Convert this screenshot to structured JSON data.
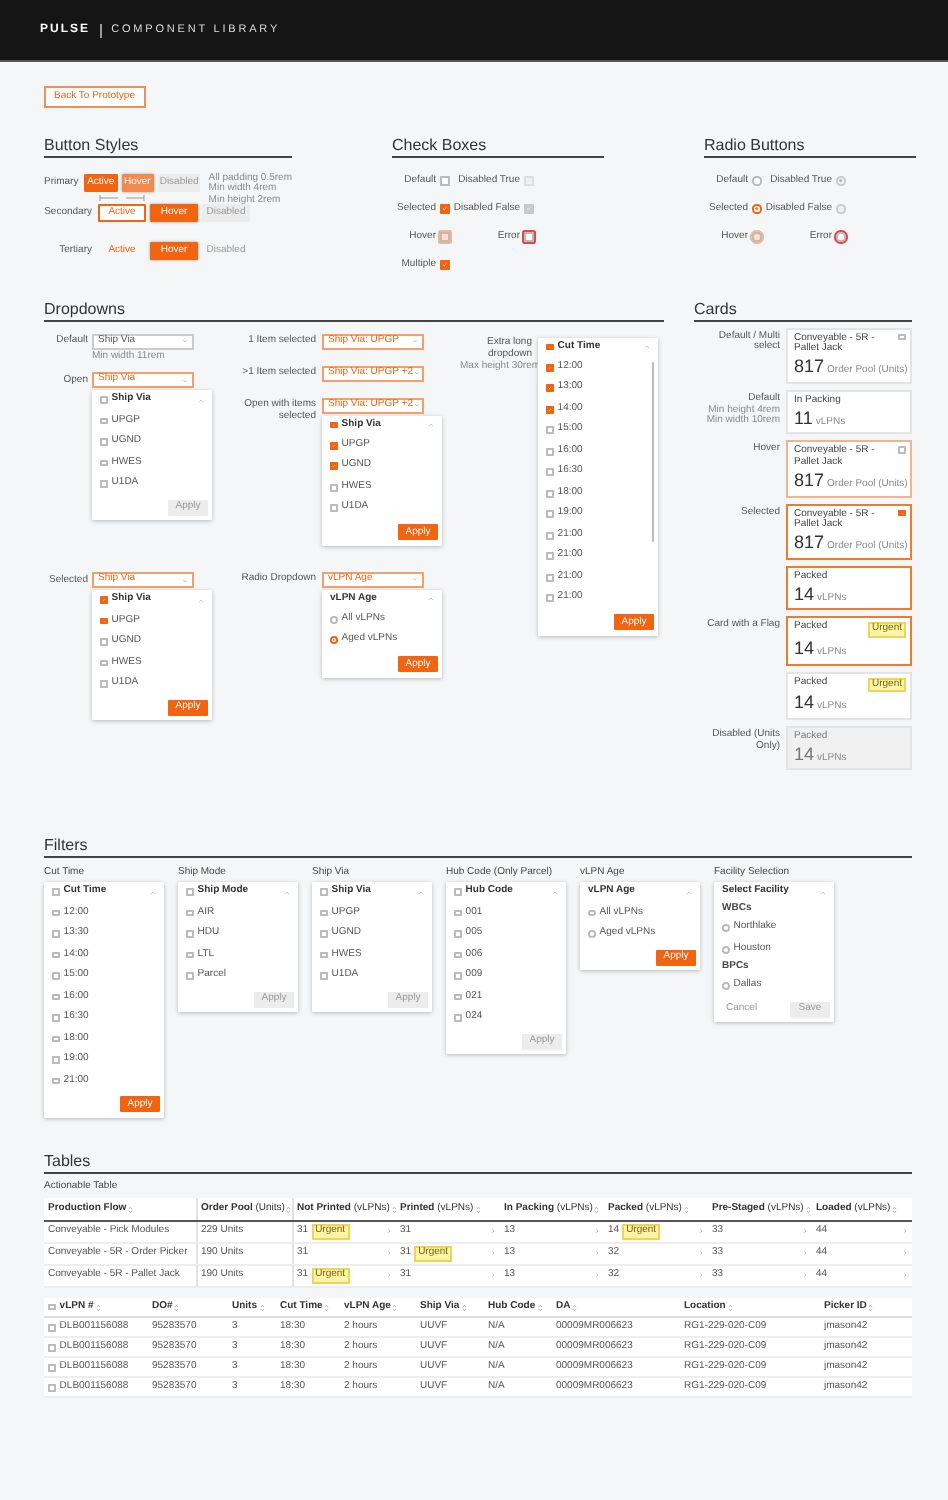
{
  "header": {
    "logo": "PULSE",
    "title": "COMPONENT LIBRARY"
  },
  "back_button": "Back To Prototype",
  "button_styles": {
    "title": "Button Styles",
    "rows": [
      {
        "label": "Primary",
        "kind": "primary",
        "buttons": [
          {
            "text": "Active",
            "hover": false,
            "disabled": false
          },
          {
            "text": "Hover",
            "hover": true,
            "disabled": false
          },
          {
            "text": "Disabled",
            "hover": false,
            "disabled": true
          }
        ]
      },
      {
        "label": "Secondary",
        "kind": "secondary",
        "buttons": [
          {
            "text": "Active",
            "hover": false,
            "disabled": false
          },
          {
            "text": "Hover",
            "hover": true,
            "disabled": false
          },
          {
            "text": "Disabled",
            "hover": false,
            "disabled": true
          }
        ]
      },
      {
        "label": "Tertiary",
        "kind": "tertiary",
        "buttons": [
          {
            "text": "Active",
            "hover": false,
            "disabled": false
          },
          {
            "text": "Hover",
            "hover": true,
            "disabled": false
          },
          {
            "text": "Disabled",
            "hover": false,
            "disabled": true
          }
        ]
      }
    ],
    "notes": [
      "All padding 0.5rem",
      "Min width 4rem",
      "Min height 2rem"
    ]
  },
  "check_boxes": {
    "title": "Check Boxes",
    "columns": [
      [
        {
          "label": "Default",
          "checked": false,
          "disabled": false,
          "hover": false,
          "error": false
        },
        {
          "label": "Selected",
          "checked": true,
          "disabled": false,
          "hover": false,
          "error": false
        },
        {
          "label": "Hover",
          "checked": false,
          "disabled": false,
          "hover": true,
          "error": false
        },
        {
          "label": "Multiple",
          "checked": true,
          "disabled": false,
          "hover": false,
          "error": false
        }
      ],
      [
        {
          "label": "Disabled True",
          "checked": false,
          "disabled": true,
          "hover": false,
          "error": false
        },
        {
          "label": "Disabled False",
          "checked": true,
          "disabled": true,
          "hover": false,
          "error": false
        },
        {
          "label": "Error",
          "checked": false,
          "disabled": false,
          "hover": false,
          "error": true
        }
      ]
    ]
  },
  "radio_buttons": {
    "title": "Radio Buttons",
    "columns": [
      [
        {
          "label": "Default",
          "selected": false,
          "disabled": false,
          "hover": false,
          "error": false
        },
        {
          "label": "Selected",
          "selected": true,
          "disabled": false,
          "hover": false,
          "error": false
        },
        {
          "label": "Hover",
          "selected": false,
          "disabled": false,
          "hover": true,
          "error": false
        }
      ],
      [
        {
          "label": "Disabled True",
          "selected": true,
          "disabled": true,
          "hover": false,
          "error": false
        },
        {
          "label": "Disabled False",
          "selected": false,
          "disabled": true,
          "hover": false,
          "error": false
        },
        {
          "label": "Error",
          "selected": false,
          "disabled": false,
          "hover": false,
          "error": true
        }
      ]
    ]
  },
  "dropdowns": {
    "title": "Dropdowns",
    "columns": [
      [
        {
          "label": "Default",
          "note": "Min width 11rem",
          "field": {
            "text": "Ship Via",
            "active": false
          }
        },
        {
          "label": "Open",
          "field": {
            "text": "Ship Via",
            "active": true
          },
          "menu": {
            "kind": "checkbox",
            "header": {
              "text": "Ship Via",
              "checked": false,
              "partial": false
            },
            "options": [
              {
                "text": "UPGP",
                "checked": false
              },
              {
                "text": "UGND",
                "checked": false
              },
              {
                "text": "HWES",
                "checked": false
              },
              {
                "text": "U1DA",
                "checked": false
              }
            ],
            "apply": {
              "text": "Apply",
              "disabled": true
            }
          }
        },
        {
          "label": "Selected",
          "field": {
            "text": "Ship Via",
            "active": true
          },
          "menu": {
            "kind": "checkbox",
            "header": {
              "text": "Ship Via",
              "checked": true,
              "partial": false
            },
            "options": [
              {
                "text": "UPGP",
                "checked": true
              },
              {
                "text": "UGND",
                "checked": false
              },
              {
                "text": "HWES",
                "checked": false
              },
              {
                "text": "U1DA",
                "checked": false
              }
            ],
            "apply": {
              "text": "Apply",
              "disabled": false
            }
          }
        }
      ],
      [
        {
          "label": "1 Item selected",
          "field": {
            "text": "Ship Via: UPGP",
            "active": true
          }
        },
        {
          "label": ">1 Item selected",
          "field": {
            "text": "Ship Via: UPGP +2",
            "active": true
          }
        },
        {
          "label": "Open with items selected",
          "field": {
            "text": "Ship Via: UPGP +2",
            "active": true
          },
          "menu": {
            "kind": "checkbox",
            "header": {
              "text": "Ship Via",
              "checked": true,
              "partial": true
            },
            "options": [
              {
                "text": "UPGP",
                "checked": true
              },
              {
                "text": "UGND",
                "checked": true
              },
              {
                "text": "HWES",
                "checked": false
              },
              {
                "text": "U1DA",
                "checked": false
              }
            ],
            "apply": {
              "text": "Apply",
              "disabled": false
            }
          }
        },
        {
          "label": "Radio Dropdown",
          "field": {
            "text": "vLPN Age",
            "active": true
          },
          "menu": {
            "kind": "radio",
            "header": {
              "text": "vLPN Age"
            },
            "options": [
              {
                "text": "All vLPNs",
                "selected": false
              },
              {
                "text": "Aged vLPNs",
                "selected": true
              }
            ],
            "apply": {
              "text": "Apply",
              "disabled": false
            }
          }
        }
      ],
      [
        {
          "label": "Extra long dropdown",
          "note": "Max height 30rem",
          "menu": {
            "kind": "checkbox",
            "scroll": true,
            "header": {
              "text": "Cut Time",
              "checked": true,
              "partial": true
            },
            "options": [
              {
                "text": "12:00",
                "checked": true
              },
              {
                "text": "13:00",
                "checked": true
              },
              {
                "text": "14:00",
                "checked": true
              },
              {
                "text": "15:00",
                "checked": false
              },
              {
                "text": "16:00",
                "checked": false
              },
              {
                "text": "16:30",
                "checked": false
              },
              {
                "text": "18:00",
                "checked": false
              },
              {
                "text": "19:00",
                "checked": false
              },
              {
                "text": "21:00",
                "checked": false
              },
              {
                "text": "21:00",
                "checked": false
              },
              {
                "text": "21:00",
                "checked": false
              },
              {
                "text": "21:00",
                "checked": false
              }
            ],
            "apply": {
              "text": "Apply",
              "disabled": false
            }
          }
        }
      ]
    ]
  },
  "cards": {
    "title": "Cards",
    "rows": [
      {
        "label": "Default / Multi select",
        "card": {
          "kind": "multi",
          "title": "Conveyable - 5R - Pallet Jack",
          "value": "817",
          "unit": "Order Pool (Units)",
          "hover": false,
          "selected": false,
          "disabled": false,
          "checked": false
        }
      },
      {
        "label": "Default",
        "notes": [
          "Min height 4rem",
          "Min width 10rem"
        ],
        "card": {
          "kind": "plain",
          "title": "In Packing",
          "value": "11",
          "unit": "vLPNs",
          "hover": false,
          "selected": false,
          "disabled": false
        }
      },
      {
        "label": "Hover",
        "card": {
          "kind": "multi",
          "title": "Conveyable - 5R - Pallet Jack",
          "value": "817",
          "unit": "Order Pool (Units)",
          "hover": true,
          "selected": false,
          "disabled": false,
          "checked": false
        }
      },
      {
        "label": "Selected",
        "card": {
          "kind": "multi",
          "title": "Conveyable - 5R - Pallet Jack",
          "value": "817",
          "unit": "Order Pool (Units)",
          "hover": false,
          "selected": true,
          "disabled": false,
          "checked": true
        }
      },
      {
        "card": {
          "kind": "plain",
          "title": "Packed",
          "value": "14",
          "unit": "vLPNs",
          "hover": false,
          "selected": true,
          "disabled": false
        }
      },
      {
        "label": "Card with a Flag",
        "card": {
          "kind": "plain",
          "title": "Packed",
          "value": "14",
          "unit": "vLPNs",
          "hover": false,
          "selected": true,
          "disabled": false,
          "flag": "Urgent"
        }
      },
      {
        "card": {
          "kind": "plain",
          "title": "Packed",
          "value": "14",
          "unit": "vLPNs",
          "hover": false,
          "selected": false,
          "disabled": false,
          "flag": "Urgent"
        }
      },
      {
        "label": "Disabled (Units Only)",
        "card": {
          "kind": "plain",
          "title": "Packed",
          "value": "14",
          "unit": "vLPNs",
          "hover": false,
          "selected": false,
          "disabled": true
        }
      }
    ]
  },
  "filters": {
    "title": "Filters",
    "panels": [
      {
        "title": "Cut Time",
        "menu": {
          "kind": "checkbox",
          "header": {
            "text": "Cut Time",
            "checked": false,
            "partial": false
          },
          "options": [
            {
              "text": "12:00",
              "checked": false
            },
            {
              "text": "13:30",
              "checked": false
            },
            {
              "text": "14:00",
              "checked": false
            },
            {
              "text": "15:00",
              "checked": false
            },
            {
              "text": "16:00",
              "checked": false
            },
            {
              "text": "16:30",
              "checked": false
            },
            {
              "text": "18:00",
              "checked": false
            },
            {
              "text": "19:00",
              "checked": false
            },
            {
              "text": "21:00",
              "checked": false
            }
          ],
          "apply": {
            "text": "Apply",
            "disabled": false
          }
        }
      },
      {
        "title": "Ship Mode",
        "menu": {
          "kind": "checkbox",
          "header": {
            "text": "Ship Mode",
            "checked": false,
            "partial": false
          },
          "options": [
            {
              "text": "AIR",
              "checked": false
            },
            {
              "text": "HDU",
              "checked": false
            },
            {
              "text": "LTL",
              "checked": false
            },
            {
              "text": "Parcel",
              "checked": false
            }
          ],
          "apply": {
            "text": "Apply",
            "disabled": true
          }
        }
      },
      {
        "title": "Ship Via",
        "menu": {
          "kind": "checkbox",
          "header": {
            "text": "Ship Via",
            "checked": false,
            "partial": false
          },
          "options": [
            {
              "text": "UPGP",
              "checked": false
            },
            {
              "text": "UGND",
              "checked": false
            },
            {
              "text": "HWES",
              "checked": false
            },
            {
              "text": "U1DA",
              "checked": false
            }
          ],
          "apply": {
            "text": "Apply",
            "disabled": true
          }
        }
      },
      {
        "title": "Hub Code (Only Parcel)",
        "menu": {
          "kind": "checkbox",
          "header": {
            "text": "Hub Code",
            "checked": false,
            "partial": false
          },
          "options": [
            {
              "text": "001",
              "checked": false
            },
            {
              "text": "005",
              "checked": false
            },
            {
              "text": "006",
              "checked": false
            },
            {
              "text": "009",
              "checked": false
            },
            {
              "text": "021",
              "checked": false
            },
            {
              "text": "024",
              "checked": false
            }
          ],
          "apply": {
            "text": "Apply",
            "disabled": true
          }
        }
      },
      {
        "title": "vLPN Age",
        "menu": {
          "kind": "radio",
          "header": {
            "text": "vLPN Age"
          },
          "options": [
            {
              "text": "All vLPNs",
              "selected": false
            },
            {
              "text": "Aged vLPNs",
              "selected": false
            }
          ],
          "apply": {
            "text": "Apply",
            "disabled": false
          }
        }
      },
      {
        "title": "Facility Selection",
        "menu": {
          "kind": "groups",
          "header": {
            "text": "Select Facility"
          },
          "groups": [
            {
              "name": "WBCs",
              "options": [
                {
                  "text": "Northlake",
                  "selected": false
                },
                {
                  "text": "Houston",
                  "selected": false
                }
              ]
            },
            {
              "name": "BPCs",
              "options": [
                {
                  "text": "Dallas",
                  "selected": false
                }
              ]
            }
          ],
          "cancel": "Cancel",
          "apply": {
            "text": "Save",
            "disabled": true
          }
        }
      }
    ]
  },
  "tables": {
    "title": "Tables",
    "actionable": {
      "caption": "Actionable Table",
      "columns": [
        "Production Flow",
        "**Order Pool** (Units)",
        "**Not Printed** (vLPNs)",
        "**Printed** (vLPNs)",
        "**In Packing** (vLPNs)",
        "**Packed** (vLPNs)",
        "**Pre-Staged** (vLPNs)",
        "**Loaded** (vLPNs)"
      ],
      "rows": [
        {
          "cells": [
            {
              "value": "Conveyable - Pick Modules"
            },
            {
              "value": "229 Units"
            },
            {
              "value": "31",
              "flag": "Urgent"
            },
            {
              "value": "31"
            },
            {
              "value": "13"
            },
            {
              "value": "14",
              "flag": "Urgent"
            },
            {
              "value": "33"
            },
            {
              "value": "44"
            }
          ]
        },
        {
          "cells": [
            {
              "value": "Conveyable - 5R - Order Picker"
            },
            {
              "value": "190 Units"
            },
            {
              "value": "31"
            },
            {
              "value": "31",
              "flag": "Urgent"
            },
            {
              "value": "13"
            },
            {
              "value": "32"
            },
            {
              "value": "33"
            },
            {
              "value": "44"
            }
          ]
        },
        {
          "cells": [
            {
              "value": "Conveyable - 5R - Pallet Jack"
            },
            {
              "value": "190 Units"
            },
            {
              "value": "31",
              "flag": "Urgent"
            },
            {
              "value": "31"
            },
            {
              "value": "13"
            },
            {
              "value": "32"
            },
            {
              "value": "33"
            },
            {
              "value": "44"
            }
          ]
        }
      ]
    },
    "list": {
      "header_checked": false,
      "columns": [
        "vLPN #",
        "DO#",
        "Units",
        "Cut Time",
        "vLPN Age",
        "Ship Via",
        "Hub Code",
        "DA",
        "Location",
        "Picker ID"
      ],
      "rows": [
        {
          "checked": false,
          "cells": [
            "DLB001156088",
            "95283570",
            "3",
            "18:30",
            "2 hours",
            "UUVF",
            "N/A",
            "00009MR006623",
            "RG1-229-020-C09",
            "jmason42"
          ]
        },
        {
          "checked": false,
          "cells": [
            "DLB001156088",
            "95283570",
            "3",
            "18:30",
            "2 hours",
            "UUVF",
            "N/A",
            "00009MR006623",
            "RG1-229-020-C09",
            "jmason42"
          ]
        },
        {
          "checked": false,
          "cells": [
            "DLB001156088",
            "95283570",
            "3",
            "18:30",
            "2 hours",
            "UUVF",
            "N/A",
            "00009MR006623",
            "RG1-229-020-C09",
            "jmason42"
          ]
        },
        {
          "checked": false,
          "cells": [
            "DLB001156088",
            "95283570",
            "3",
            "18:30",
            "2 hours",
            "UUVF",
            "N/A",
            "00009MR006623",
            "RG1-229-020-C09",
            "jmason42"
          ]
        }
      ]
    }
  }
}
